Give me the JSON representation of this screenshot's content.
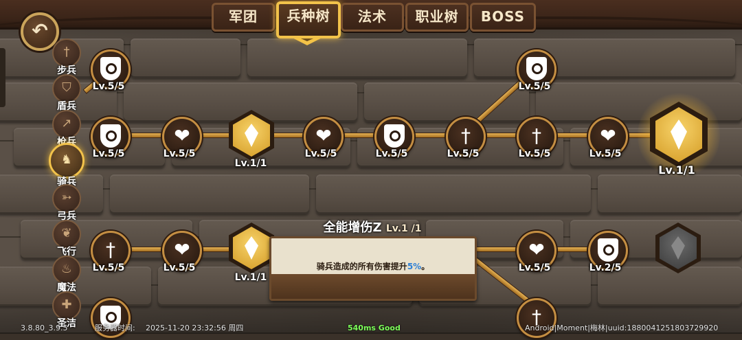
{
  "tabs": [
    "军团",
    "兵种树",
    "法术",
    "职业树",
    "BOSS"
  ],
  "active_tab": "兵种树",
  "back_icon": "back-arrow-icon",
  "side_nav": [
    {
      "label": "步兵",
      "icon": "sword-icon",
      "active": false
    },
    {
      "label": "盾兵",
      "icon": "shield-icon",
      "active": false
    },
    {
      "label": "枪兵",
      "icon": "spear-icon",
      "active": false
    },
    {
      "label": "骑兵",
      "icon": "horse-icon",
      "active": true
    },
    {
      "label": "弓兵",
      "icon": "bow-icon",
      "active": false
    },
    {
      "label": "飞行",
      "icon": "wing-icon",
      "active": false
    },
    {
      "label": "魔法",
      "icon": "fire-icon",
      "active": false
    },
    {
      "label": "圣洁",
      "icon": "cross-icon",
      "active": false
    }
  ],
  "nodes": [
    {
      "id": "n1",
      "type": "shield",
      "level": "Lv.5/5"
    },
    {
      "id": "n2",
      "type": "shield",
      "level": "Lv.5/5"
    },
    {
      "id": "n3",
      "type": "heart",
      "level": "Lv.5/5"
    },
    {
      "id": "n4",
      "type": "gem",
      "level": "Lv.1/1"
    },
    {
      "id": "n5",
      "type": "heart",
      "level": "Lv.5/5"
    },
    {
      "id": "n6",
      "type": "shield",
      "level": "Lv.5/5"
    },
    {
      "id": "n7",
      "type": "sword",
      "level": "Lv.5/5"
    },
    {
      "id": "n8",
      "type": "shield",
      "level": "Lv.5/5"
    },
    {
      "id": "n9",
      "type": "sword",
      "level": "Lv.5/5"
    },
    {
      "id": "n10",
      "type": "heart",
      "level": "Lv.5/5"
    },
    {
      "id": "n11",
      "type": "gem",
      "level": "Lv.1/1"
    },
    {
      "id": "n12",
      "type": "sword",
      "level": "Lv.5/5"
    },
    {
      "id": "n13",
      "type": "heart",
      "level": "Lv.5/5"
    },
    {
      "id": "n14",
      "type": "gem",
      "level": "Lv.1/1"
    },
    {
      "id": "n15",
      "type": "heart",
      "level": "Lv.5/5"
    },
    {
      "id": "n16",
      "type": "shield",
      "level": "Lv.2/5"
    },
    {
      "id": "n17",
      "type": "gem-locked",
      "level": ""
    },
    {
      "id": "n18",
      "type": "shield",
      "level": ""
    },
    {
      "id": "n19",
      "type": "sword",
      "level": ""
    }
  ],
  "tooltip": {
    "title": "全能增伤Z",
    "title_level": "Lv.1 /1",
    "desc_prefix": "骑兵造成的所有伤害提升",
    "desc_value": "5%",
    "desc_suffix": "。"
  },
  "status_bar": {
    "version": "3.8.80_3.9.5",
    "server_time_label": "服务器时间:",
    "datetime": "2025-11-20  23:32:56  周四",
    "ping": "540ms Good",
    "device": "Android|Moment|梅林|uuid:1880041251803729920"
  }
}
